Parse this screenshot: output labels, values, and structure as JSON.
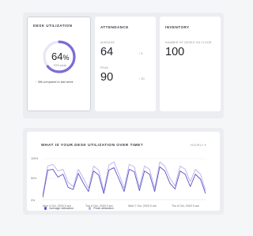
{
  "desk_utilization": {
    "title": "DESK UTILIZATION",
    "percent": "64",
    "percent_sign": "%",
    "peak_label": "93% peak",
    "compare_strong": "1%",
    "compare_text": "compared to last week",
    "arc_fraction": 0.64,
    "peak_fraction": 0.93,
    "accent": "#7b6cd6"
  },
  "attendance": {
    "title": "ATTENDANCE",
    "average_label": "AVERAGE",
    "average_value": "64",
    "average_change": "3",
    "peak_label": "PEAK",
    "peak_value": "90",
    "peak_change": "10"
  },
  "inventory": {
    "title": "INVENTORY",
    "desks_label": "NUMBER OF DESKS ON FLOOR",
    "desks_value": "100"
  },
  "chart_section": {
    "title": "WHAT IS YOUR DESK UTILIZATION OVER TIME?",
    "range_select": "HOURLY",
    "legend_average": "Average utilization",
    "legend_peak": "Peak utilization"
  },
  "chart_data": {
    "type": "line",
    "ylim": [
      0,
      100
    ],
    "y_ticks": [
      "100%",
      "50%",
      "0%"
    ],
    "x_ticks": [
      "Mon 3 Oct, 2020 9 am",
      "Tue 6 Oct, 2020 9 am",
      "Wed 7 Oct, 2020 9 am",
      "Thu 8 Oct, 2020 9 am"
    ],
    "colors": {
      "average": "#5b4fc7",
      "peak": "#b8b1ea"
    },
    "series": [
      {
        "name": "Average utilization",
        "values": [
          5,
          72,
          74,
          55,
          62,
          30,
          25,
          64,
          40,
          20,
          70,
          60,
          15,
          72,
          78,
          50,
          20,
          74,
          68,
          22,
          70,
          62,
          20,
          80,
          70,
          40,
          26,
          70,
          62,
          32,
          62,
          50,
          15
        ]
      },
      {
        "name": "Peak utilization",
        "values": [
          10,
          82,
          86,
          70,
          74,
          42,
          32,
          74,
          52,
          28,
          82,
          72,
          22,
          84,
          92,
          62,
          28,
          86,
          80,
          30,
          82,
          74,
          28,
          92,
          82,
          52,
          34,
          82,
          74,
          44,
          74,
          62,
          22
        ]
      }
    ]
  }
}
